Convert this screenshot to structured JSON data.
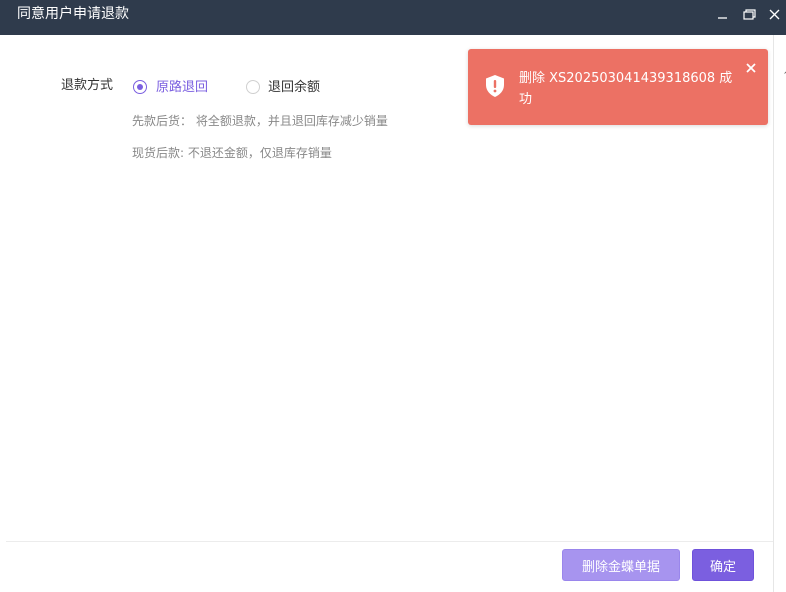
{
  "window": {
    "title": "同意用户申请退款",
    "controls": {
      "minimize_icon": "minimize-icon",
      "maximize_icon": "restore-icon",
      "close_icon": "close-icon"
    }
  },
  "form": {
    "refund_method_label": "退款方式",
    "options": [
      {
        "label": "原路退回",
        "selected": true
      },
      {
        "label": "退回余额",
        "selected": false
      }
    ],
    "hints": [
      "先款后货： 将全额退款，并且退回库存减少销量",
      "现货后款: 不退还金额，仅退库存销量"
    ]
  },
  "footer": {
    "delete_button_label": "删除金蝶单据",
    "confirm_button_label": "确定",
    "cutoff_left": "",
    "cutoff_right": ""
  },
  "toast": {
    "message": "删除 XS20250304143931860​8 成功",
    "icon": "shield-alert-icon",
    "close_icon": "close-icon"
  },
  "colors": {
    "titlebar": "#2f3b4c",
    "accent": "#7b5fe0",
    "accent_light": "#a794ef",
    "toast_bg": "#ec7164"
  }
}
